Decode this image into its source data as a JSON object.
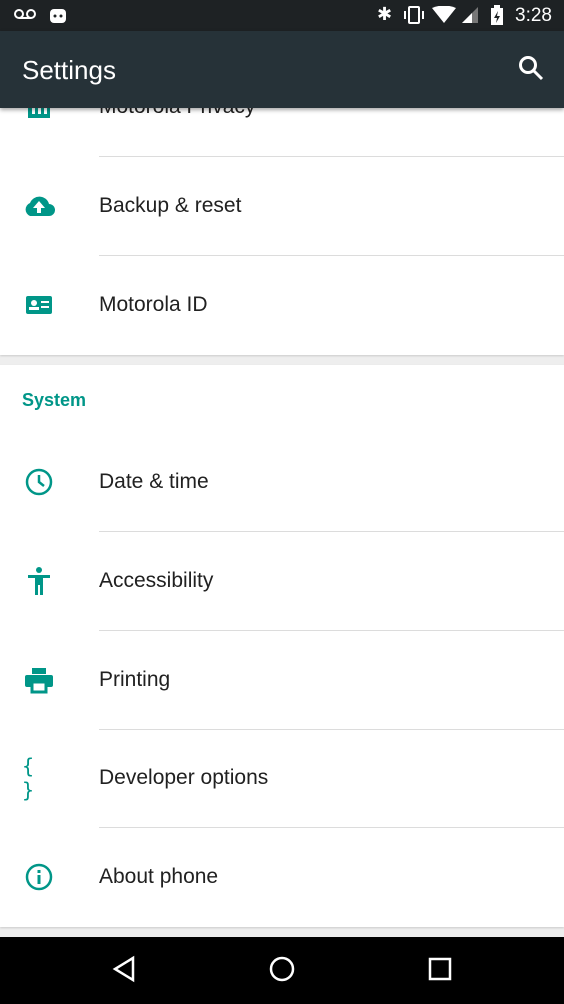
{
  "status_bar": {
    "time": "3:28",
    "icons": [
      "voicemail-icon",
      "android-icon",
      "bluetooth-icon",
      "vibrate-icon",
      "wifi-icon",
      "signal-icon",
      "battery-charging-icon"
    ]
  },
  "toolbar": {
    "title": "Settings",
    "search_icon": "search-icon"
  },
  "accent": "#009688",
  "card1": {
    "items": [
      {
        "label": "Motorola Privacy",
        "icon": "privacy-icon"
      },
      {
        "label": "Backup & reset",
        "icon": "cloud-upload-icon"
      },
      {
        "label": "Motorola ID",
        "icon": "id-card-icon"
      }
    ]
  },
  "system": {
    "header": "System",
    "items": [
      {
        "label": "Date & time",
        "icon": "clock-icon"
      },
      {
        "label": "Accessibility",
        "icon": "accessibility-icon"
      },
      {
        "label": "Printing",
        "icon": "printer-icon"
      },
      {
        "label": "Developer options",
        "icon": "braces-icon"
      },
      {
        "label": "About phone",
        "icon": "info-icon"
      }
    ]
  },
  "nav_bar": {
    "buttons": [
      "back",
      "home",
      "recents"
    ]
  }
}
